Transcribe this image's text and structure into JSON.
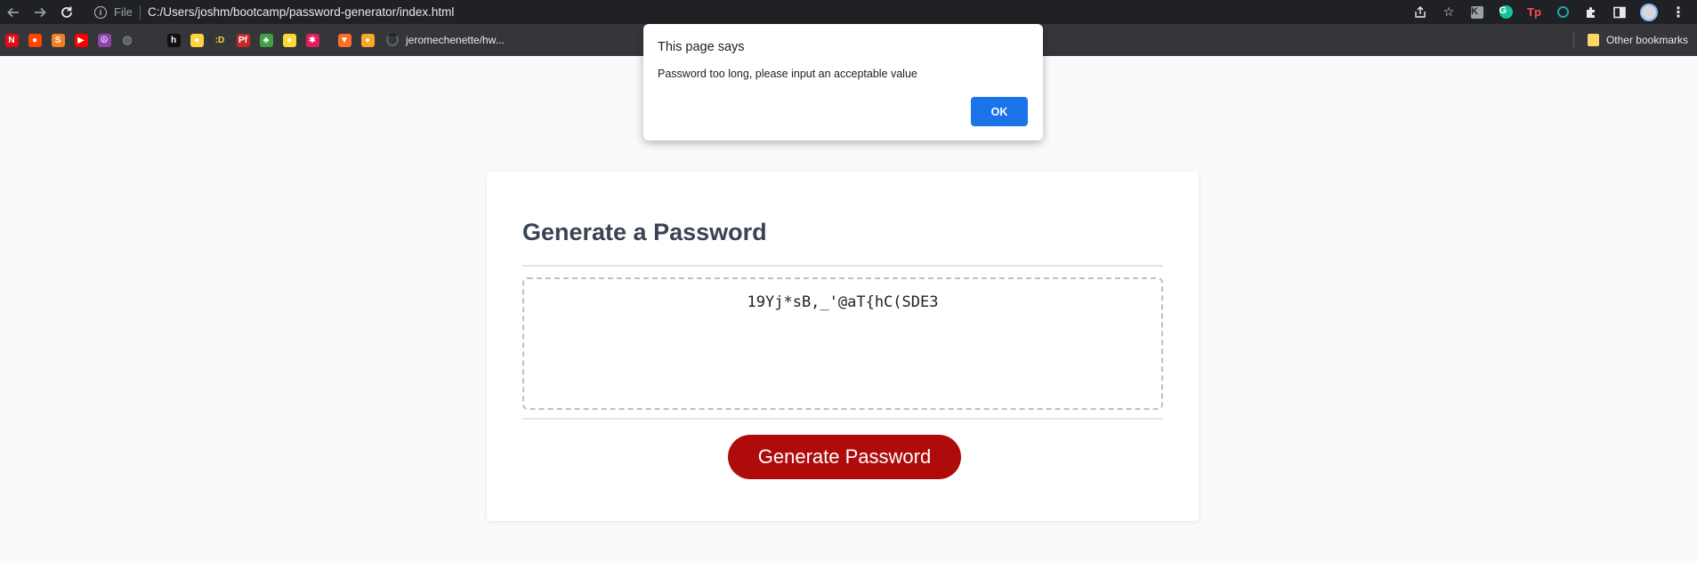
{
  "browser": {
    "file_label": "File",
    "url": "C:/Users/joshm/bootcamp/password-generator/index.html",
    "toolbar_icons": [
      "back-icon",
      "forward-icon",
      "reload-icon",
      "info-icon",
      "share-icon",
      "star-icon",
      "extension-k-icon",
      "grammarly-icon",
      "tp-icon",
      "ring-extension-icon",
      "puzzle-icon",
      "side-panel-icon",
      "avatar",
      "kebab-menu-icon"
    ]
  },
  "bookmarks": {
    "items": [
      {
        "icon": "netflix-icon",
        "glyph": "N",
        "color": "#e50914"
      },
      {
        "icon": "reddit-icon",
        "glyph": "●",
        "color": "#ff4500"
      },
      {
        "icon": "stackoverflow-icon",
        "glyph": "S",
        "color": "#f48024"
      },
      {
        "icon": "youtube-icon",
        "glyph": "▶",
        "color": "#ff0000"
      },
      {
        "icon": "peace-icon",
        "glyph": "☮",
        "color": "#8e44ad"
      },
      {
        "icon": "globe-icon",
        "glyph": "◍",
        "color": "#9aa0a6"
      },
      {
        "icon": "apple-icon",
        "glyph": "",
        "color": "#bdc1c6"
      },
      {
        "icon": "hulu-icon",
        "glyph": "h",
        "color": "#111111"
      },
      {
        "icon": "python-icon",
        "glyph": "●",
        "color": "#ffd43b"
      },
      {
        "icon": "colon-d-icon",
        "glyph": ":D",
        "color": "#35363a"
      },
      {
        "icon": "pf-icon",
        "glyph": "Pf",
        "color": "#c62828"
      },
      {
        "icon": "tree-icon",
        "glyph": "♣",
        "color": "#43a047"
      },
      {
        "icon": "lemon-icon",
        "glyph": "●",
        "color": "#fdd835"
      },
      {
        "icon": "slack-icon",
        "glyph": "✱",
        "color": "#e01e5a"
      },
      {
        "icon": "gitlab-icon",
        "glyph": "▼",
        "color": "#fc6d26"
      },
      {
        "icon": "coin-icon",
        "glyph": "●",
        "color": "#f9a825"
      }
    ],
    "text_item": "jeromechenette/hw...",
    "other_bookmarks": "Other bookmarks"
  },
  "page": {
    "title": "Generate a Password",
    "password": "19Yj*sB,_'@aT{hC(SDE3",
    "button_label": "Generate Password"
  },
  "dialog": {
    "title": "This page says",
    "message": "Password too long, please input an acceptable value",
    "ok_label": "OK"
  },
  "colors": {
    "button_red": "#b00b0b",
    "ok_blue": "#1a73e8",
    "title_slate": "#394453"
  }
}
